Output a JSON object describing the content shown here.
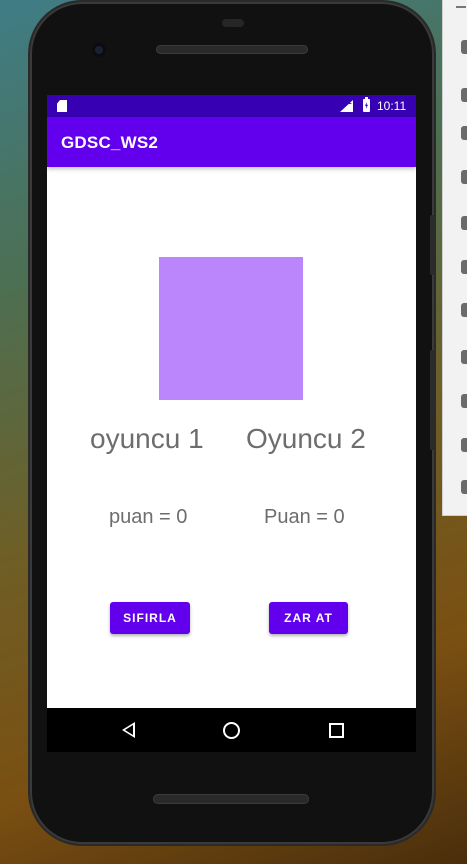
{
  "status_bar": {
    "network": "LTE",
    "time": "10:11"
  },
  "app_bar": {
    "title": "GDSC_WS2"
  },
  "game": {
    "dice_color": "#bb86fc",
    "players": [
      {
        "name": "oyuncu 1",
        "score_text": "puan = 0"
      },
      {
        "name": "Oyuncu 2",
        "score_text": "Puan = 0"
      }
    ],
    "buttons": {
      "reset_label": "SIFIRLA",
      "roll_label": "ZAR AT"
    }
  },
  "colors": {
    "primary": "#6200ee",
    "primary_dark": "#3700b3",
    "accent": "#bb86fc"
  },
  "icons": [
    "sd-card-icon",
    "lte-signal-icon",
    "battery-icon",
    "back-icon",
    "home-icon",
    "recents-icon"
  ]
}
